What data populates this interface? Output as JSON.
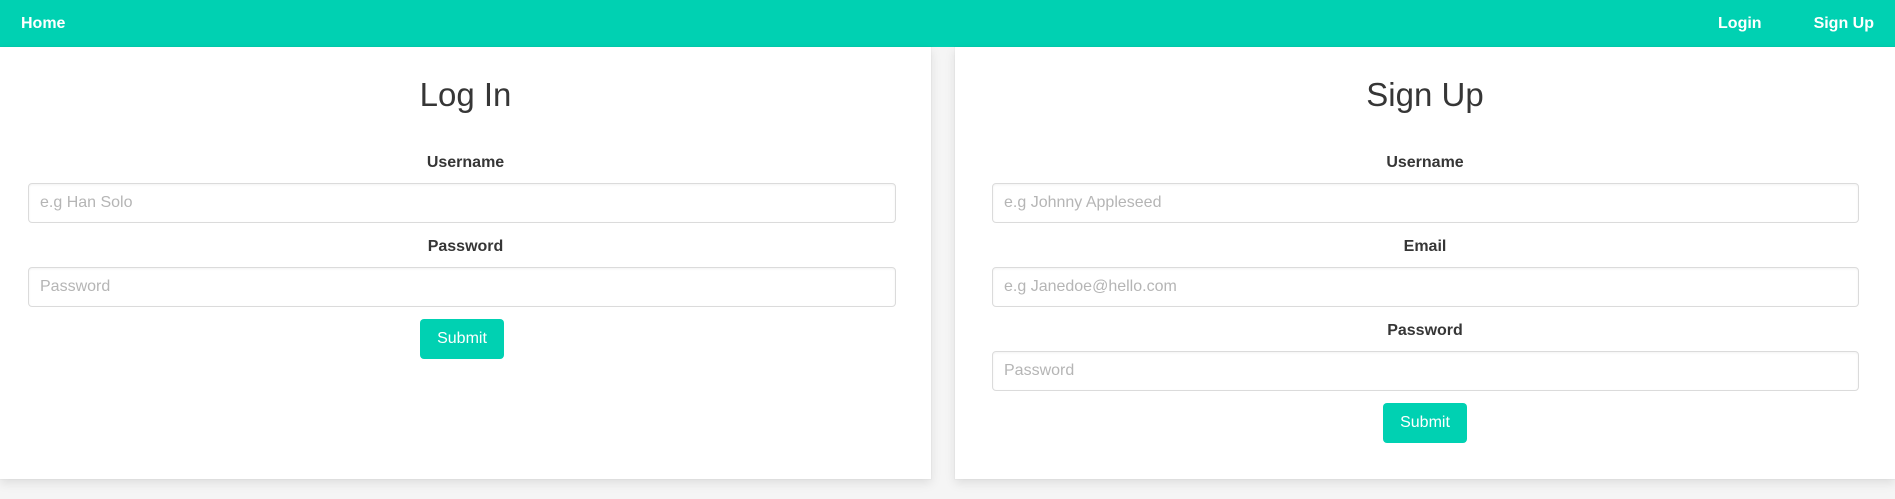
{
  "nav": {
    "home": "Home",
    "login": "Login",
    "signup": "Sign Up"
  },
  "login": {
    "title": "Log In",
    "username_label": "Username",
    "username_placeholder": "e.g Han Solo",
    "password_label": "Password",
    "password_placeholder": "Password",
    "submit": "Submit"
  },
  "signup": {
    "title": "Sign Up",
    "username_label": "Username",
    "username_placeholder": "e.g Johnny Appleseed",
    "email_label": "Email",
    "email_placeholder": "e.g Janedoe@hello.com",
    "password_label": "Password",
    "password_placeholder": "Password",
    "submit": "Submit"
  },
  "colors": {
    "accent": "#00d1b2",
    "text": "#363636",
    "placeholder": "#b5b5b5",
    "border": "#dbdbdb"
  }
}
